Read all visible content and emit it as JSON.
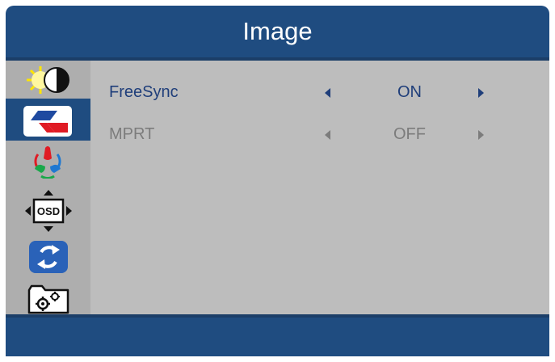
{
  "header": {
    "title": "Image"
  },
  "sidebar": {
    "items": [
      {
        "icon": "brightness-contrast-icon",
        "selected": false
      },
      {
        "icon": "image-icon",
        "selected": true
      },
      {
        "icon": "color-icon",
        "selected": false
      },
      {
        "icon": "osd-position-icon",
        "label": "OSD",
        "selected": false
      },
      {
        "icon": "reset-icon",
        "selected": false
      },
      {
        "icon": "settings-icon",
        "selected": false
      }
    ]
  },
  "menu": {
    "items": [
      {
        "label": "FreeSync",
        "value": "ON",
        "enabled": true
      },
      {
        "label": "MPRT",
        "value": "OFF",
        "enabled": false
      }
    ]
  },
  "colors": {
    "frame": "#1f4c80",
    "sidebar": "#aeaeae",
    "content": "#bdbdbd",
    "active_text": "#1f3e7a",
    "inactive_text": "#7c7c7c"
  }
}
